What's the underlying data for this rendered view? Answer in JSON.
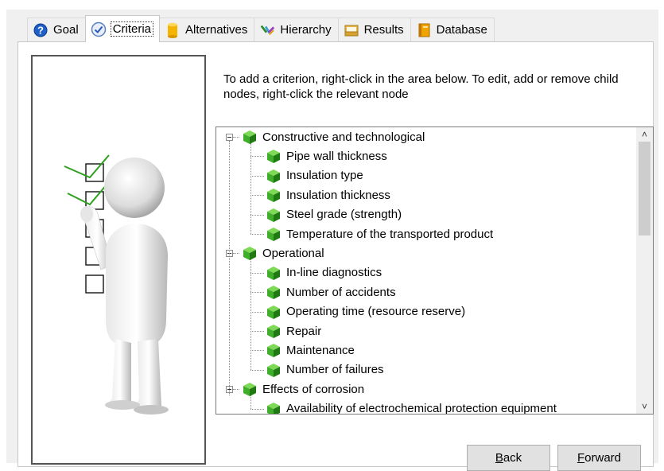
{
  "tabs": [
    {
      "label": "Goal",
      "icon": "question-icon",
      "active": false
    },
    {
      "label": "Criteria",
      "icon": "checkmark-icon",
      "active": true
    },
    {
      "label": "Alternatives",
      "icon": "cylinder-icon",
      "active": false
    },
    {
      "label": "Hierarchy",
      "icon": "hierarchy-icon",
      "active": false
    },
    {
      "label": "Results",
      "icon": "folder-icon",
      "active": false
    },
    {
      "label": "Database",
      "icon": "database-book-icon",
      "active": false
    }
  ],
  "instructions": "To add a criterion, right-click in the area below. To edit, add or remove child nodes, right-click the relevant node",
  "tree": [
    {
      "label": "Constructive and technological",
      "children": [
        "Pipe wall thickness",
        "Insulation type",
        "Insulation thickness",
        "Steel grade (strength)",
        "Temperature of the transported product"
      ]
    },
    {
      "label": "Operational",
      "children": [
        "In-line diagnostics",
        "Number of accidents",
        "Operating time (resource reserve)",
        "Repair",
        "Maintenance",
        "Number of failures"
      ]
    },
    {
      "label": "Effects of corrosion",
      "children": [
        "Availability of electrochemical protection equipment"
      ]
    }
  ],
  "buttons": {
    "back": {
      "mnemonic": "B",
      "rest": "ack"
    },
    "forward": {
      "mnemonic": "F",
      "rest": "orward"
    }
  },
  "colors": {
    "cube": "#3fae2a",
    "cube_dark": "#1f7a12",
    "accent": "#0078d7"
  }
}
